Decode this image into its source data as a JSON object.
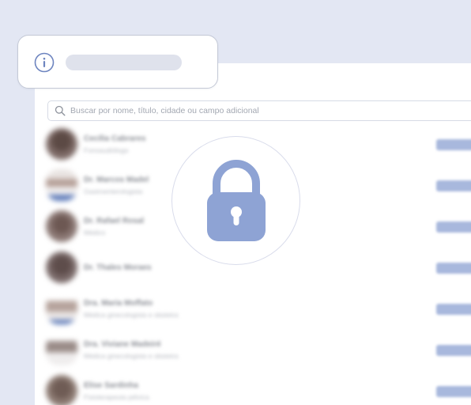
{
  "search": {
    "placeholder": "Buscar por nome, título, cidade ou campo adicional",
    "icon": "search-icon"
  },
  "people": [
    {
      "name": "Cecília Cabrares",
      "subtitle": "Fonoaudióloga",
      "avatar_color": "#7d6a66"
    },
    {
      "name": "Dr. Marcos Madel",
      "subtitle": "Gastroenterologista",
      "avatar_color": "#c9c3c1"
    },
    {
      "name": "Dr. Rafael Rosal",
      "subtitle": "Médico",
      "avatar_color": "#8a7773"
    },
    {
      "name": "Dr. Thales Moraes",
      "subtitle": "",
      "avatar_color": "#7a6a69"
    },
    {
      "name": "Dra. Maria Moffato",
      "subtitle": "Médica ginecologista e obstetra",
      "avatar_color": "#b6a39c"
    },
    {
      "name": "Dra. Viviane Madeiré",
      "subtitle": "Médica ginecologista e obstetra",
      "avatar_color": "#9a8c88"
    },
    {
      "name": "Elise Sardinha",
      "subtitle": "Fisioterapeuta pélvica",
      "avatar_color": "#8c7a72"
    }
  ],
  "info_card": {
    "icon": "info-icon"
  },
  "lock": {
    "icon": "padlock-icon",
    "color": "#8ea3d4"
  },
  "colors": {
    "background": "#e3e7f3",
    "panel": "#ffffff",
    "accent": "#a8b8dd"
  }
}
